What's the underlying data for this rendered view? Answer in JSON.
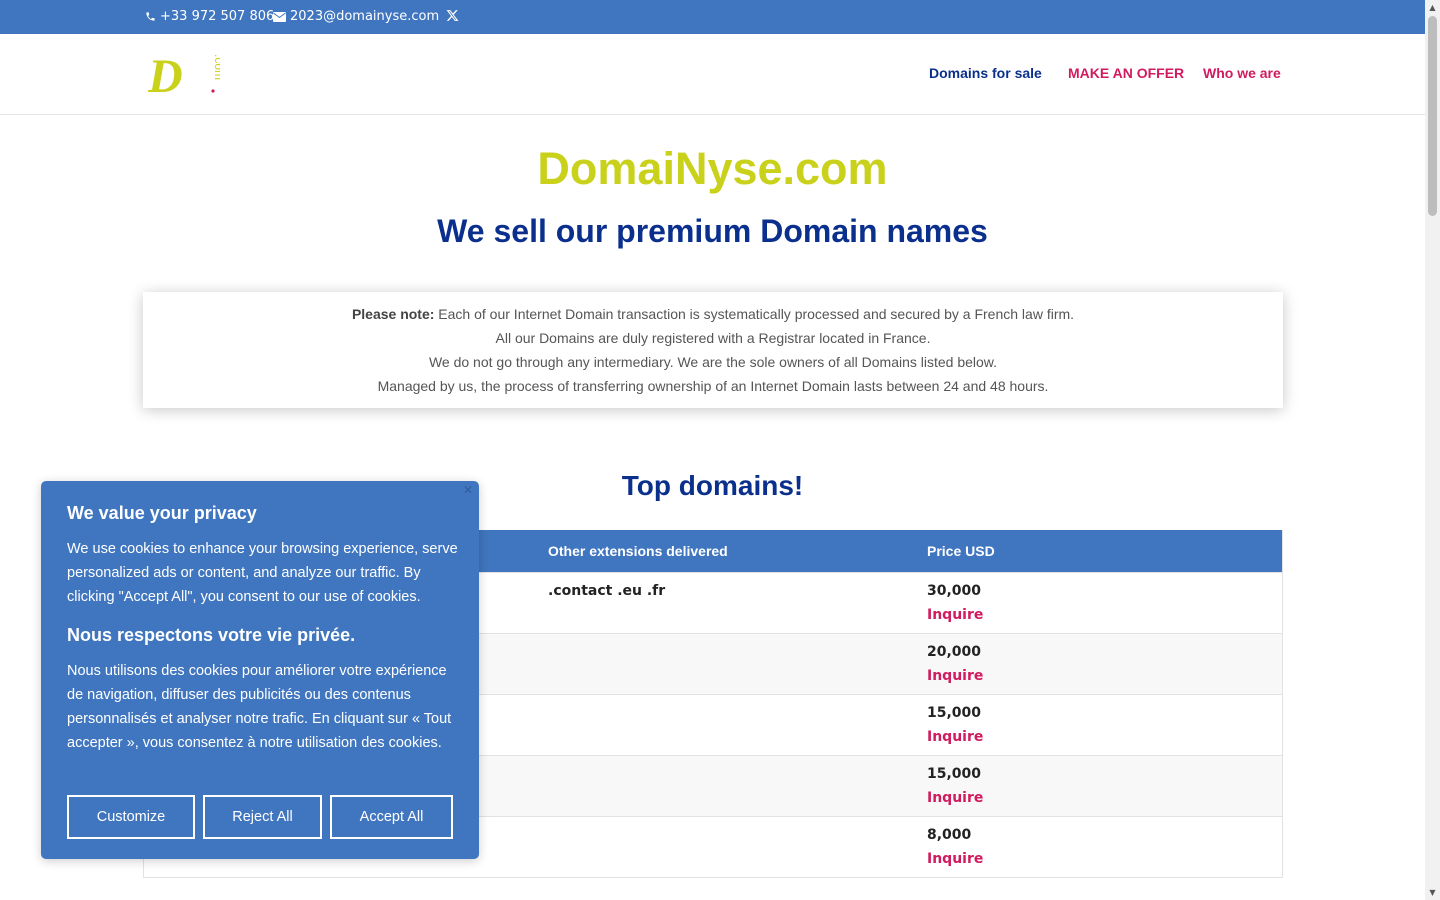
{
  "topbar": {
    "phone": "+33 972 507 806",
    "email": "2023@domainyse.com",
    "phone_icon": "phone-icon",
    "email_icon": "envelope-icon",
    "social_icon": "x-twitter-icon"
  },
  "header": {
    "logo_letter": "D",
    "logo_suffix": ".com",
    "nav": [
      {
        "label": "Domains for sale",
        "color": "#0b2f8c"
      },
      {
        "label": "MAKE AN OFFER",
        "color": "#d11b5e"
      },
      {
        "label": "Who we are",
        "color": "#d11b5e"
      }
    ]
  },
  "hero": {
    "brand": "DomaiNyse.com",
    "tagline": "We sell our premium Domain names"
  },
  "note": {
    "label": "Please note:",
    "line1": " Each of our Internet Domain transaction is systematically processed and secured by a French law firm.",
    "line2": "All our Domains are duly registered with a Registrar located in France.",
    "line3": "We do not go through any intermediary. We are the sole owners of all Domains listed below.",
    "line4": "Managed by us, the process of transferring ownership of an Internet Domain lasts between 24 and 48 hours."
  },
  "top_domains": {
    "title": "Top domains!",
    "headers": {
      "extensions": "Other extensions delivered",
      "price": "Price USD"
    },
    "rows": [
      {
        "extensions": ".contact .eu .fr",
        "price": "30,000",
        "action": "Inquire"
      },
      {
        "extensions": "",
        "price": "20,000",
        "action": "Inquire"
      },
      {
        "extensions": "",
        "price": "15,000",
        "action": "Inquire"
      },
      {
        "extensions": "",
        "price": "15,000",
        "action": "Inquire"
      },
      {
        "extensions": "",
        "price": "8,000",
        "action": "Inquire"
      }
    ]
  },
  "cookie": {
    "title_en": "We value your privacy",
    "body_en": "We use cookies to enhance your browsing experience, serve personalized ads or content, and analyze our traffic. By clicking \"Accept All\", you consent to our use of cookies.",
    "title_fr": "Nous respectons votre vie privée.",
    "body_fr": "Nous utilisons des cookies pour améliorer votre expérience de navigation, diffuser des publicités ou des contenus personnalisés et analyser notre trafic. En cliquant sur « Tout accepter », vous consentez à notre utilisation des cookies.",
    "customize": "Customize",
    "reject": "Reject All",
    "accept": "Accept All",
    "close_icon": "close-icon"
  },
  "colors": {
    "primary_blue": "#4076bf",
    "navy": "#0b2f8c",
    "brand_lime": "#c9d11a",
    "accent_pink": "#d11b5e"
  }
}
